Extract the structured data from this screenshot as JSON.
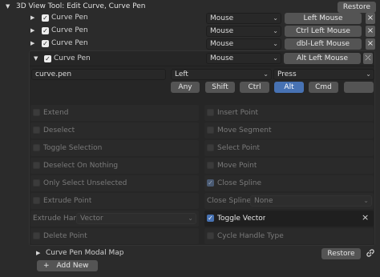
{
  "header": {
    "title": "3D View Tool: Edit Curve, Curve Pen",
    "restore_label": "Restore"
  },
  "keymap_rows": [
    {
      "name": "Curve Pen",
      "input": "Mouse",
      "key": "Left Mouse"
    },
    {
      "name": "Curve Pen",
      "input": "Mouse",
      "key": "Ctrl Left Mouse"
    },
    {
      "name": "Curve Pen",
      "input": "Mouse",
      "key": "dbl-Left Mouse"
    }
  ],
  "expanded": {
    "name": "Curve Pen",
    "input": "Mouse",
    "key": "Alt Left Mouse",
    "operator": "curve.pen",
    "button": "Left",
    "event": "Press",
    "modifiers": [
      "Any",
      "Shift",
      "Ctrl",
      "Alt",
      "Cmd",
      ""
    ],
    "options_left": [
      "Extend",
      "Deselect",
      "Toggle Selection",
      "Deselect On Nothing",
      "Only Select Unselected",
      "Extrude Point"
    ],
    "extrude_handle_label": "Extrude Han...",
    "extrude_handle_value": "Vector",
    "options_left_last": "Delete Point",
    "options_right": [
      "Insert Point",
      "Move Segment",
      "Select Point",
      "Move Point",
      "Close Spline"
    ],
    "close_spline_label": "Close Spline ...",
    "close_spline_value": "None",
    "toggle_vector_label": "Toggle Vector",
    "cycle_handle_label": "Cycle Handle Type"
  },
  "modal_map": {
    "label": "Curve Pen Modal Map",
    "restore_label": "Restore"
  },
  "add_new_label": "Add New"
}
